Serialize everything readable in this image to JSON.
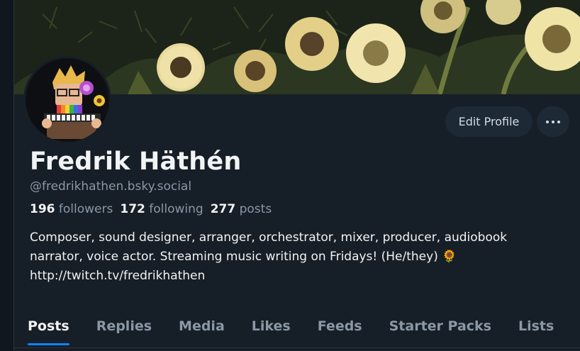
{
  "profile": {
    "display_name": "Fredrik Häthén",
    "handle": "@fredrikhathen.bsky.social",
    "stats": {
      "followers_count": "196",
      "followers_label": "followers",
      "following_count": "172",
      "following_label": "following",
      "posts_count": "277",
      "posts_label": "posts"
    },
    "bio": {
      "line1": "Composer, sound designer, arranger, orchestrator, mixer, producer, audiobook",
      "line2": "narrator, voice actor. Streaming music writing on Fridays! (He/they) 🌻",
      "line3": "http://twitch.tv/fredrikhathen"
    }
  },
  "actions": {
    "edit_profile_label": "Edit Profile"
  },
  "tabs": [
    {
      "label": "Posts",
      "active": true
    },
    {
      "label": "Replies"
    },
    {
      "label": "Media"
    },
    {
      "label": "Likes"
    },
    {
      "label": "Feeds"
    },
    {
      "label": "Starter Packs"
    },
    {
      "label": "Lists"
    }
  ],
  "colors": {
    "background": "#161e27",
    "button": "#1e2936",
    "accent": "#1083fe",
    "muted_text": "#8a98a6"
  }
}
